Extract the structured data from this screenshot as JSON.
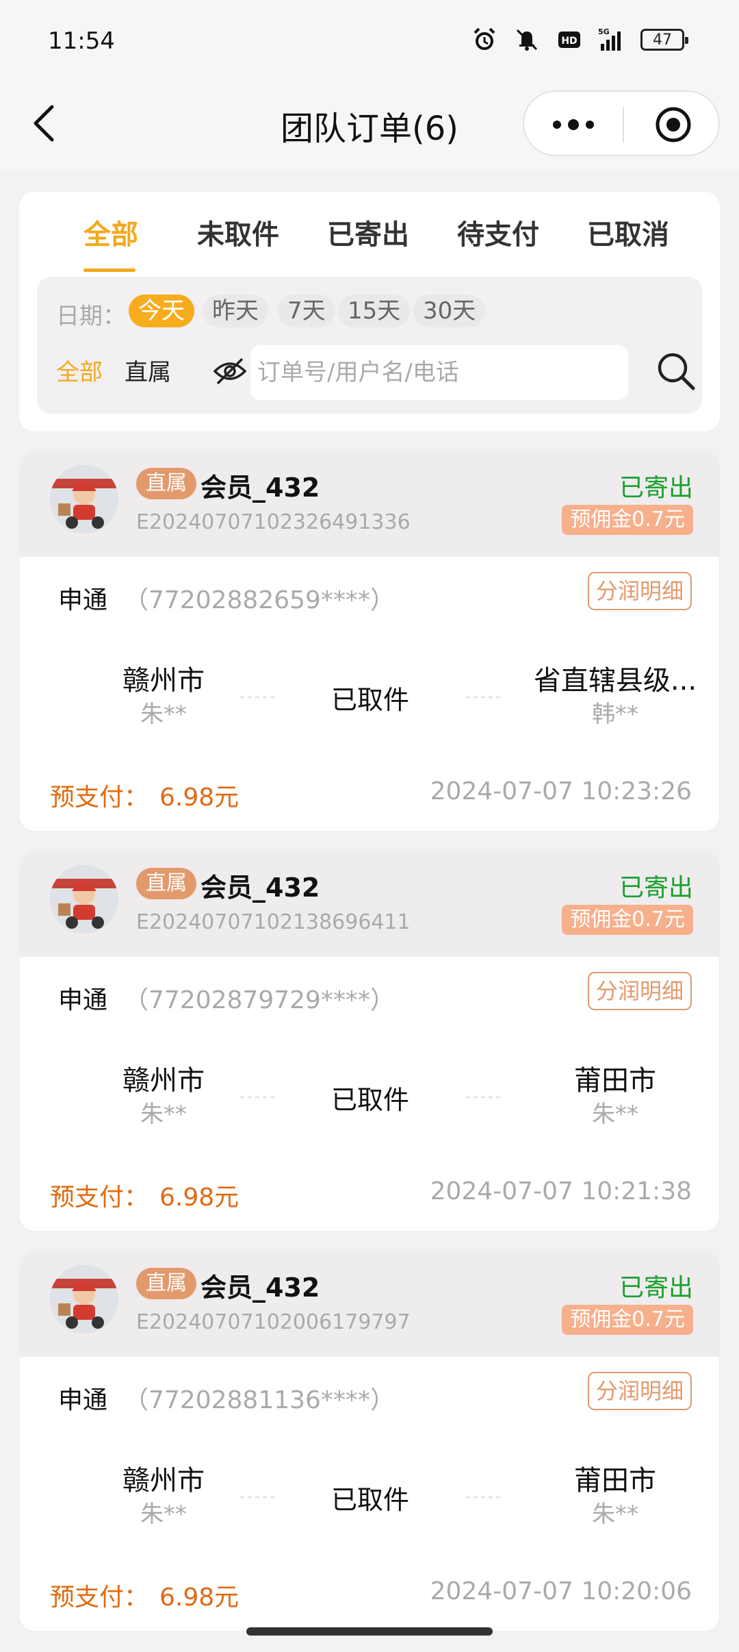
{
  "status_bar": {
    "time": "11:54",
    "battery": "47"
  },
  "header": {
    "title": "团队订单(6)"
  },
  "tabs": [
    {
      "label": "全部",
      "active": true
    },
    {
      "label": "未取件",
      "active": false
    },
    {
      "label": "已寄出",
      "active": false
    },
    {
      "label": "待支付",
      "active": false
    },
    {
      "label": "已取消",
      "active": false
    }
  ],
  "filters": {
    "date_label": "日期：",
    "date_chips": [
      "今天",
      "昨天",
      "7天",
      "15天",
      "30天"
    ],
    "active_chip": "今天",
    "type_all": "全部",
    "type_direct": "直属",
    "search_placeholder": "订单号/用户名/电话"
  },
  "orders": [
    {
      "badge": "直属",
      "member": "会员_432",
      "order_no": "E20240707102326491336",
      "status": "已寄出",
      "commission": "预佣金0.7元",
      "carrier": "申通",
      "tracking": "（77202882659****）",
      "detail_label": "分润明细",
      "from_city": "赣州市",
      "from_person": "朱**",
      "pickup_status": "已取件",
      "to_city": "省直辖县级...",
      "to_person": "韩**",
      "prepay_label": "预支付：",
      "prepay_amount": "6.98元",
      "datetime": "2024-07-07 10:23:26"
    },
    {
      "badge": "直属",
      "member": "会员_432",
      "order_no": "E20240707102138696411",
      "status": "已寄出",
      "commission": "预佣金0.7元",
      "carrier": "申通",
      "tracking": "（77202879729****）",
      "detail_label": "分润明细",
      "from_city": "赣州市",
      "from_person": "朱**",
      "pickup_status": "已取件",
      "to_city": "莆田市",
      "to_person": "朱**",
      "prepay_label": "预支付：",
      "prepay_amount": "6.98元",
      "datetime": "2024-07-07 10:21:38"
    },
    {
      "badge": "直属",
      "member": "会员_432",
      "order_no": "E20240707102006179797",
      "status": "已寄出",
      "commission": "预佣金0.7元",
      "carrier": "申通",
      "tracking": "（77202881136****）",
      "detail_label": "分润明细",
      "from_city": "赣州市",
      "from_person": "朱**",
      "pickup_status": "已取件",
      "to_city": "莆田市",
      "to_person": "朱**",
      "prepay_label": "预支付：",
      "prepay_amount": "6.98元",
      "datetime": "2024-07-07 10:20:06"
    }
  ],
  "colors": {
    "accent": "#f3a91b",
    "status_green": "#17a12b",
    "badge": "#e29a6c",
    "prepay": "#e06a12"
  },
  "icons": [
    "alarm-icon",
    "mute-icon",
    "hd-icon",
    "signal-5g-icon",
    "battery-icon",
    "back-icon",
    "more-icon",
    "target-icon",
    "eye-hidden-icon",
    "search-icon"
  ]
}
